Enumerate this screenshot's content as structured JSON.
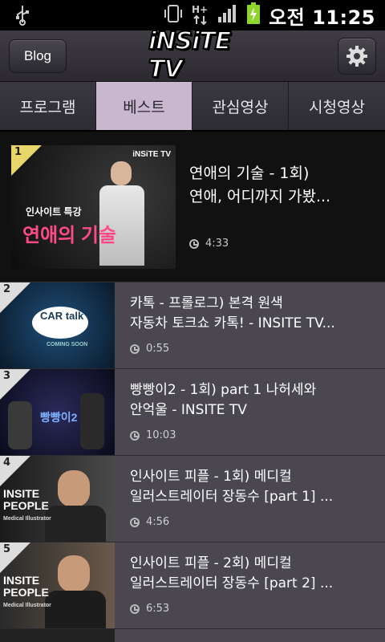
{
  "status_bar": {
    "time": "오전 11:25",
    "icons": [
      "usb-icon",
      "vibrate-icon",
      "hsdpa-icon",
      "signal-icon",
      "battery-charging-icon"
    ],
    "network_label": "H+"
  },
  "header": {
    "blog_label": "Blog",
    "logo_text": "iNSiTE TV",
    "settings_icon": "gear-icon"
  },
  "tabs": [
    {
      "label": "프로그램",
      "active": false
    },
    {
      "label": "베스트",
      "active": true
    },
    {
      "label": "관심영상",
      "active": false
    },
    {
      "label": "시청영상",
      "active": false
    }
  ],
  "videos": [
    {
      "rank": "1",
      "title_line1": "연애의 기술 - 1회)",
      "title_line2": "연애, 어디까지 가봤...",
      "duration": "4:33",
      "thumb_caption1": "인사이트 특강",
      "thumb_caption2": "연애의 기술",
      "thumb_logo": "iNSiTE TV"
    },
    {
      "rank": "2",
      "title_line1": "카톡 - 프롤로그) 본격 원색",
      "title_line2": "자동차 토크쇼 카톡! - INSITE TV...",
      "duration": "0:55",
      "thumb_caption1": "CAR talk",
      "thumb_caption2": "COMING SOON"
    },
    {
      "rank": "3",
      "title_line1": "빵빵이2 - 1회) part 1 나허세와",
      "title_line2": "안억울 - INSITE TV",
      "duration": "10:03",
      "thumb_caption1": "빵빵이2"
    },
    {
      "rank": "4",
      "title_line1": "인사이트 피플 - 1회) 메디컬",
      "title_line2": "일러스트레이터 장동수 [part 1] ...",
      "duration": "4:56",
      "thumb_caption1": "INSITE PEOPLE",
      "thumb_caption2": "Medical Illustrator"
    },
    {
      "rank": "5",
      "title_line1": "인사이트 피플 - 2회) 메디컬",
      "title_line2": "일러스트레이터 장동수 [part 2] ...",
      "duration": "6:53",
      "thumb_caption1": "INSITE PEOPLE",
      "thumb_caption2": "Medical Illustrator"
    }
  ],
  "colors": {
    "active_tab": "#c9b7cf",
    "row_bg": "#4a4750",
    "featured_bg": "#111111",
    "rank1_badge": "#e9d66a"
  }
}
